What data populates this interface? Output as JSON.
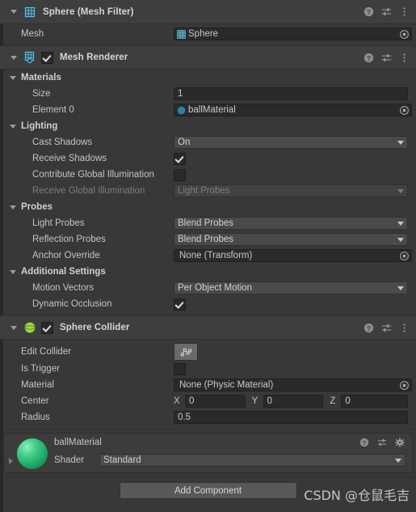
{
  "components": [
    {
      "title": "Sphere (Mesh Filter)",
      "icon": "mesh-filter-icon",
      "has_checkbox": false,
      "rows": [
        {
          "label": "Mesh",
          "type": "object",
          "value": "Sphere",
          "icon": "mesh-icon"
        }
      ]
    },
    {
      "title": "Mesh Renderer",
      "icon": "mesh-renderer-icon",
      "has_checkbox": true,
      "enabled": true,
      "sections": [
        {
          "name": "Materials",
          "rows": [
            {
              "label": "Size",
              "type": "text",
              "value": "1"
            },
            {
              "label": "Element 0",
              "type": "object",
              "value": "ballMaterial",
              "icon": "material-icon"
            }
          ]
        },
        {
          "name": "Lighting",
          "rows": [
            {
              "label": "Cast Shadows",
              "type": "dropdown",
              "value": "On"
            },
            {
              "label": "Receive Shadows",
              "type": "checkbox",
              "value": true
            },
            {
              "label": "Contribute Global Illumination",
              "type": "checkbox",
              "value": false
            },
            {
              "label": "Receive Global Illumination",
              "type": "dropdown",
              "value": "Light Probes",
              "disabled": true
            }
          ]
        },
        {
          "name": "Probes",
          "rows": [
            {
              "label": "Light Probes",
              "type": "dropdown",
              "value": "Blend Probes"
            },
            {
              "label": "Reflection Probes",
              "type": "dropdown",
              "value": "Blend Probes"
            },
            {
              "label": "Anchor Override",
              "type": "object",
              "value": "None (Transform)"
            }
          ]
        },
        {
          "name": "Additional Settings",
          "rows": [
            {
              "label": "Motion Vectors",
              "type": "dropdown",
              "value": "Per Object Motion"
            },
            {
              "label": "Dynamic Occlusion",
              "type": "checkbox",
              "value": true
            }
          ]
        }
      ]
    },
    {
      "title": "Sphere Collider",
      "icon": "sphere-collider-icon",
      "has_checkbox": true,
      "enabled": true,
      "rows": [
        {
          "label": "Edit Collider",
          "type": "button",
          "icon": "edit-collider-icon"
        },
        {
          "label": "Is Trigger",
          "type": "checkbox",
          "value": false
        },
        {
          "label": "Material",
          "type": "object",
          "value": "None (Physic Material)"
        },
        {
          "label": "Center",
          "type": "vector3",
          "axes": [
            "X",
            "Y",
            "Z"
          ],
          "values": [
            "0",
            "0",
            "0"
          ]
        },
        {
          "label": "Radius",
          "type": "text",
          "value": "0.5"
        }
      ]
    }
  ],
  "material_block": {
    "name": "ballMaterial",
    "shader_label": "Shader",
    "shader_value": "Standard",
    "preview_color": "#2fc07f"
  },
  "footer": {
    "add_component_label": "Add Component",
    "watermark": "CSDN @仓鼠毛吉"
  },
  "header_icons": {
    "help": "help-icon",
    "preset": "preset-icon",
    "menu": "kebab-menu-icon",
    "gear": "gear-icon"
  }
}
